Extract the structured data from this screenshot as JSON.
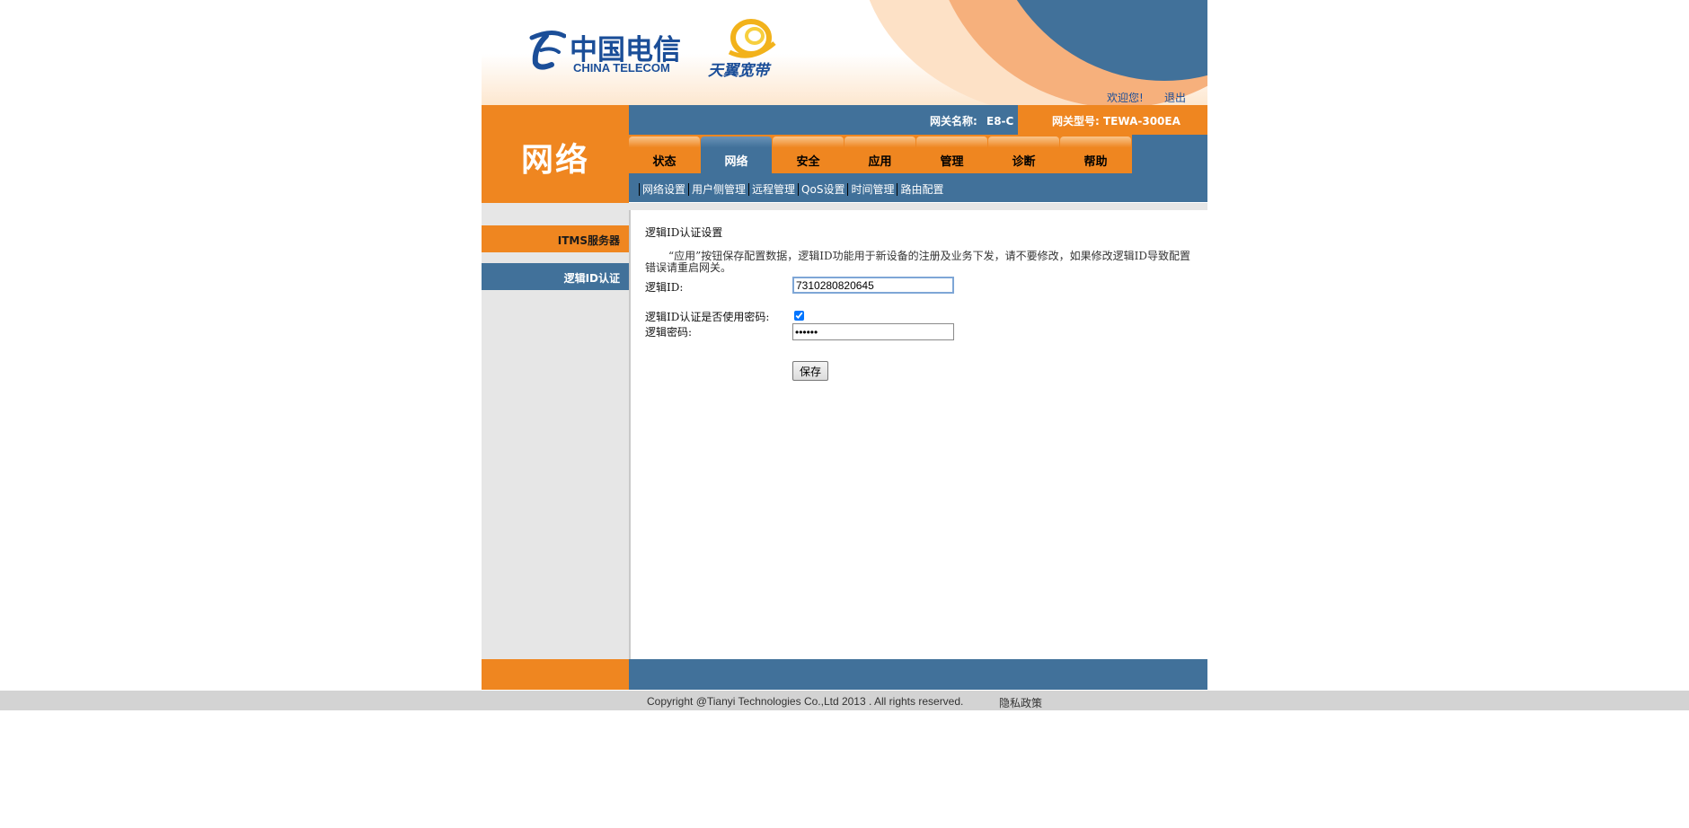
{
  "header": {
    "logo_cn": "中国电信",
    "logo_en": "CHINA TELECOM",
    "brand": "天翼宽带",
    "welcome": "欢迎您!",
    "logout": "退出"
  },
  "gateway": {
    "name_label": "网关名称:",
    "name_value": "E8-C",
    "model_label": "网关型号:",
    "model_value": "TEWA-300EA"
  },
  "section_title": "网络",
  "tabs": [
    {
      "label": "状态",
      "active": false
    },
    {
      "label": "网络",
      "active": true
    },
    {
      "label": "安全",
      "active": false
    },
    {
      "label": "应用",
      "active": false
    },
    {
      "label": "管理",
      "active": false
    },
    {
      "label": "诊断",
      "active": false
    },
    {
      "label": "帮助",
      "active": false
    }
  ],
  "subnav": [
    {
      "label": "网络设置",
      "active": false
    },
    {
      "label": "用户侧管理",
      "active": false
    },
    {
      "label": "远程管理",
      "active": true
    },
    {
      "label": "QoS设置",
      "active": false
    },
    {
      "label": "时间管理",
      "active": false
    },
    {
      "label": "路由配置",
      "active": false
    }
  ],
  "sidebar": {
    "items": [
      {
        "label": "ITMS服务器",
        "active": false
      },
      {
        "label": "逻辑ID认证",
        "active": true
      }
    ]
  },
  "content": {
    "title": "逻辑ID认证设置",
    "description": "“应用”按钮保存配置数据，逻辑ID功能用于新设备的注册及业务下发，请不要修改，如果修改逻辑ID导致配置错误请重启网关。",
    "logic_id_label": "逻辑ID:",
    "logic_id_value": "7310280820645",
    "use_password_label": "逻辑ID认证是否使用密码:",
    "use_password_checked": true,
    "password_label": "逻辑密码:",
    "password_value": "••••••",
    "save_label": "保存"
  },
  "footer": {
    "copyright": "Copyright @Tianyi Technologies Co.,Ltd 2013 . All rights reserved.",
    "privacy": "隐私政策"
  },
  "colors": {
    "orange": "#ef8620",
    "blue": "#41719a",
    "link_blue": "#1b4e98"
  }
}
